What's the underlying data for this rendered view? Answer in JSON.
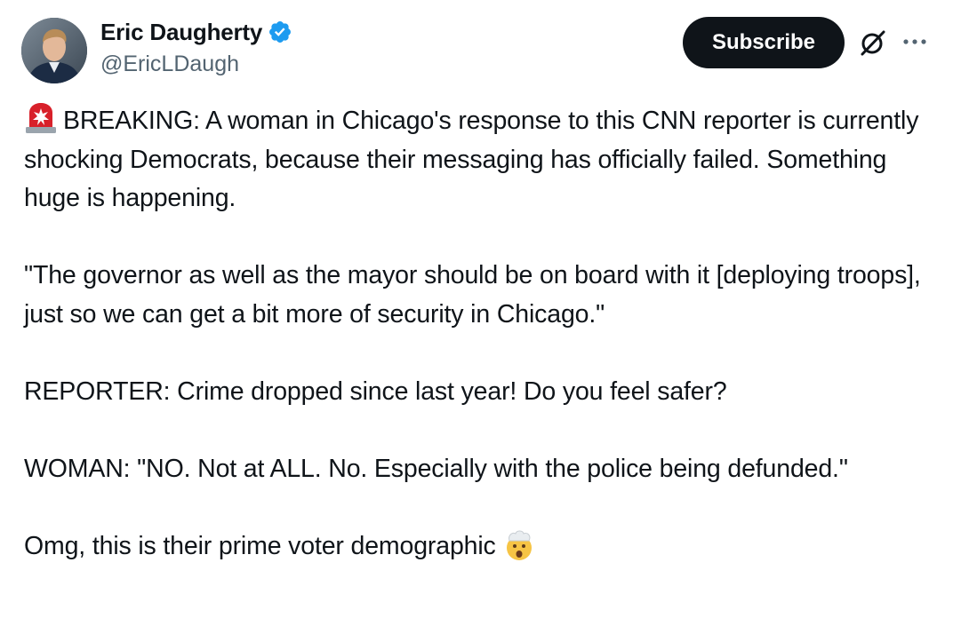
{
  "author": {
    "display_name": "Eric Daugherty",
    "handle": "@EricLDaugh",
    "verified": true
  },
  "actions": {
    "subscribe_label": "Subscribe",
    "grok_icon": "grok-icon",
    "more_icon": "more-icon"
  },
  "tweet": {
    "paragraphs": [
      {
        "lead_emoji": "rotating-light-emoji",
        "text": "BREAKING: A woman in Chicago's response to this CNN reporter is currently shocking Democrats, because their messaging has officially failed. Something huge is happening."
      },
      {
        "text": "\"The governor as well as the mayor should be on board with it [deploying troops], just so we can get a bit more of security in Chicago.\""
      },
      {
        "text": "REPORTER: Crime dropped since last year! Do you feel safer?"
      },
      {
        "text": "WOMAN: \"NO. Not at ALL. No. Especially with the police being defunded.\""
      },
      {
        "text": "Omg, this is their prime voter demographic",
        "trail_emoji": "exploding-head-emoji"
      }
    ]
  },
  "colors": {
    "text_primary": "#0f1419",
    "text_secondary": "#536471",
    "verified_blue": "#1d9bf0",
    "button_bg": "#0f1419"
  }
}
